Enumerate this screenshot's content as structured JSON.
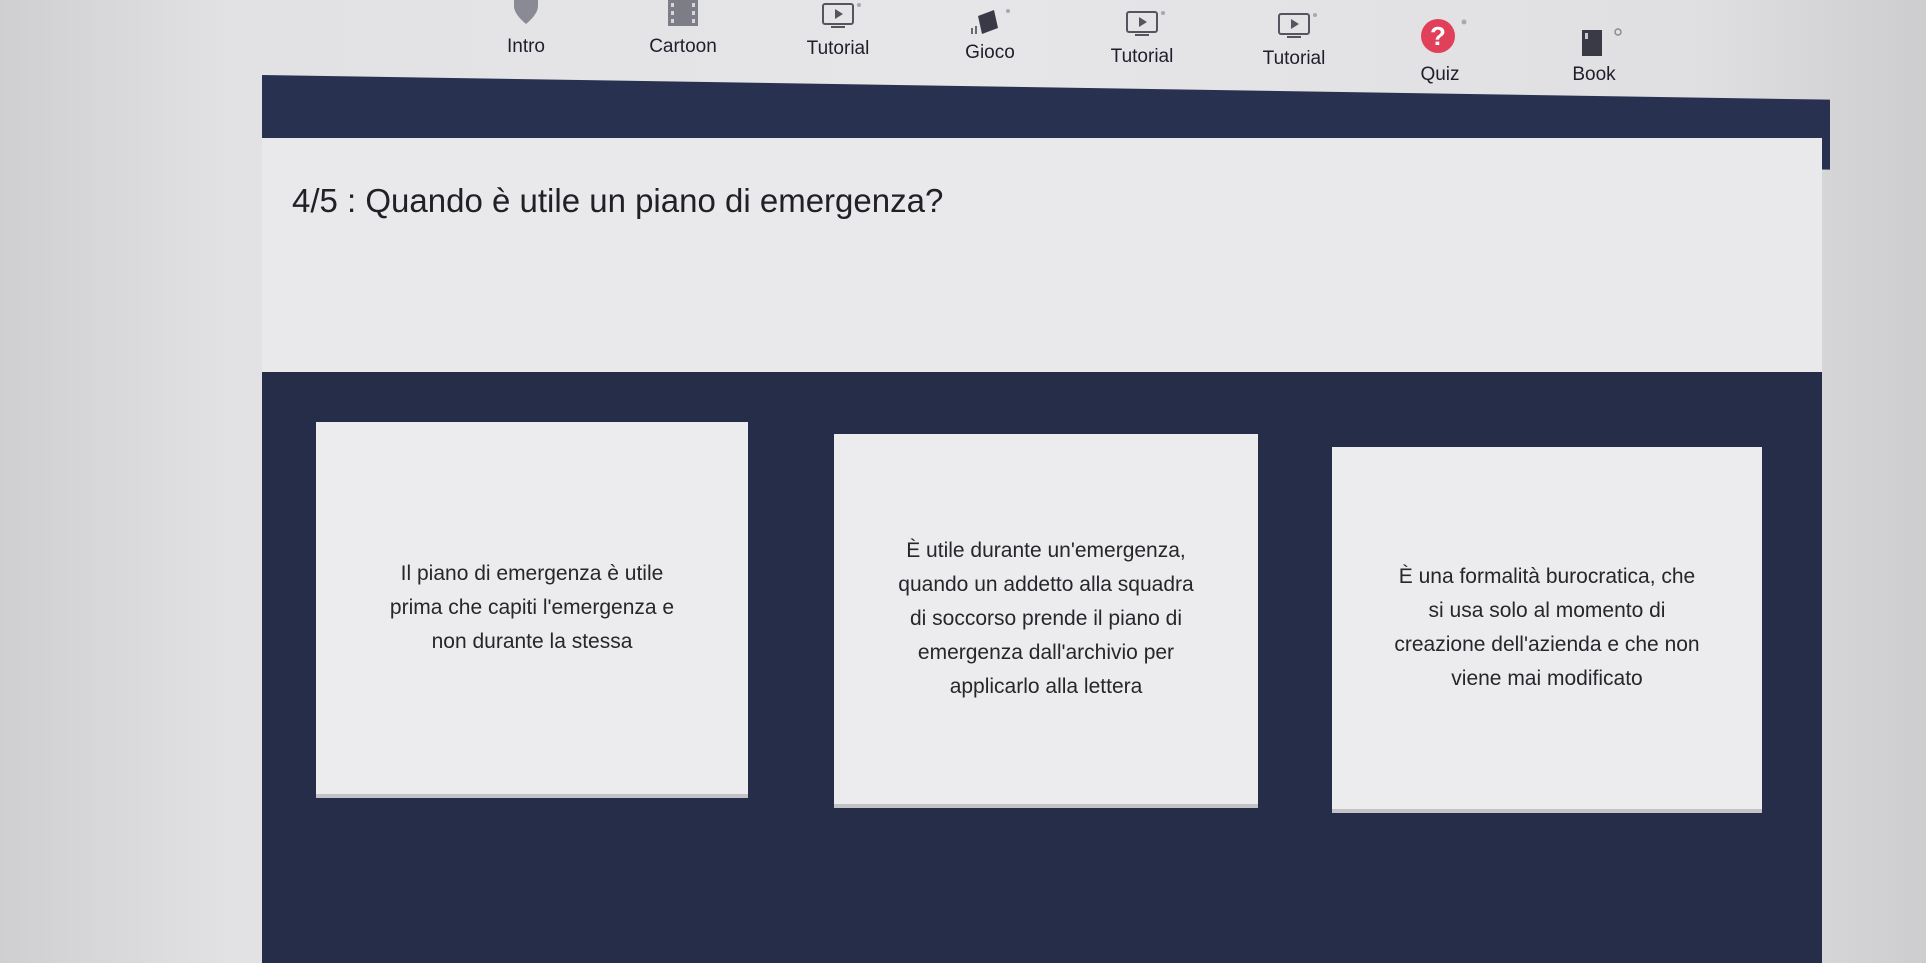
{
  "nav": {
    "items": [
      {
        "label": "Intro",
        "icon": "location-pin-icon"
      },
      {
        "label": "Cartoon",
        "icon": "film-strip-icon"
      },
      {
        "label": "Tutorial",
        "icon": "monitor-play-icon"
      },
      {
        "label": "Gioco",
        "icon": "game-cube-icon"
      },
      {
        "label": "Tutorial",
        "icon": "monitor-play-icon"
      },
      {
        "label": "Tutorial",
        "icon": "monitor-play-icon"
      },
      {
        "label": "Quiz",
        "icon": "question-circle-icon"
      },
      {
        "label": "Book",
        "icon": "book-icon"
      }
    ],
    "active": "Quiz"
  },
  "question": {
    "text": "4/5 : Quando è utile un piano di emergenza?"
  },
  "answers": [
    {
      "text": "Il piano di emergenza è utile\nprima che capiti l'emergenza e\nnon durante la stessa"
    },
    {
      "text": "È utile durante un'emergenza,\nquando un addetto alla squadra\ndi soccorso prende il piano di\nemergenza dall'archivio per\napplicarlo alla lettera"
    },
    {
      "text": "È una formalità burocratica, che\nsi usa solo al momento di\ncreazione dell'azienda e che non\nviene mai modificato"
    }
  ],
  "colors": {
    "nav_bar": "#283250",
    "answers_bg": "#252d48",
    "card_bg": "#ececee",
    "accent": "#e64d6a",
    "quiz_icon": "#e0405a"
  }
}
